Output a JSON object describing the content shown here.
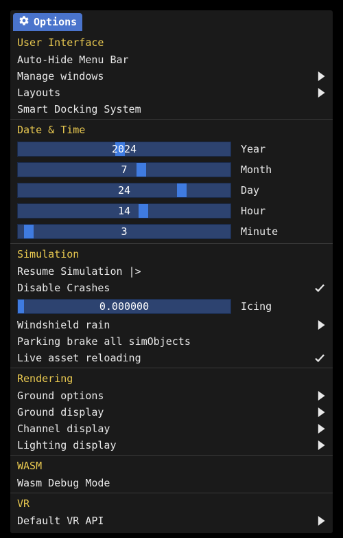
{
  "window": {
    "title": "Options"
  },
  "sections": {
    "ui": {
      "header": "User Interface",
      "auto_hide": "Auto-Hide Menu Bar",
      "manage_windows": "Manage windows",
      "layouts": "Layouts",
      "smart_docking": "Smart Docking System"
    },
    "datetime": {
      "header": "Date & Time",
      "year": {
        "label": "Year",
        "value": "2024",
        "handle_pct": 48
      },
      "month": {
        "label": "Month",
        "value": "7",
        "handle_pct": 58
      },
      "day": {
        "label": "Day",
        "value": "24",
        "handle_pct": 77
      },
      "hour": {
        "label": "Hour",
        "value": "14",
        "handle_pct": 59
      },
      "minute": {
        "label": "Minute",
        "value": "3",
        "handle_pct": 5
      }
    },
    "simulation": {
      "header": "Simulation",
      "resume": "Resume Simulation |>",
      "disable_crashes": "Disable Crashes",
      "icing": {
        "label": "Icing",
        "value": "0.000000",
        "fill_pct": 3
      },
      "windshield_rain": "Windshield rain",
      "parking_brake": "Parking brake all simObjects",
      "live_asset_reload": "Live asset reloading"
    },
    "rendering": {
      "header": "Rendering",
      "ground_options": "Ground options",
      "ground_display": "Ground display",
      "channel_display": "Channel display",
      "lighting_display": "Lighting display"
    },
    "wasm": {
      "header": "WASM",
      "debug_mode": "Wasm Debug Mode"
    },
    "vr": {
      "header": "VR",
      "default_api": "Default VR API"
    }
  }
}
